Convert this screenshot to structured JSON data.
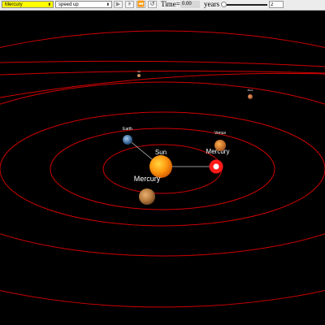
{
  "toolbar": {
    "center_select": "Mercury",
    "speed_select": "speed up",
    "buttons": [
      {
        "name": "play-button",
        "icon": "play-icon",
        "glyph": "▶",
        "disabled": true
      },
      {
        "name": "step-forward-button",
        "icon": "step-forward-icon",
        "glyph": "⏵",
        "disabled": true
      },
      {
        "name": "step-back-button",
        "icon": "rewind-icon",
        "glyph": "⏪",
        "disabled": false
      },
      {
        "name": "reset-button",
        "icon": "reset-icon",
        "glyph": "↺",
        "disabled": false
      }
    ],
    "time_label": "Time=",
    "time_value": "0.00",
    "years_label": "years",
    "speed_value": "2"
  },
  "scene": {
    "bodies": {
      "sun": "Sun",
      "mercury": "Mercury",
      "mercury_marker": "Mercury",
      "venus": "Venus",
      "earth": "Earth",
      "mars": "Mars",
      "far_planet": "Jup"
    },
    "colors": {
      "orbit": "#d10000",
      "background": "#000000",
      "select_highlight": "#ffff00"
    }
  }
}
